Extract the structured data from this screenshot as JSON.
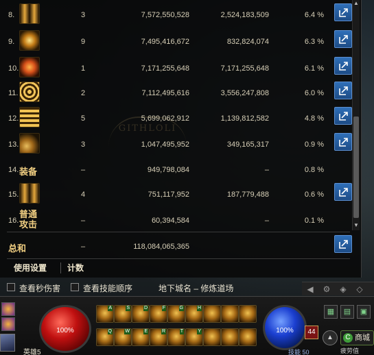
{
  "stats": {
    "rows": [
      {
        "rank": "8.",
        "icon": "claw-slash-skill-icon",
        "hits": "3",
        "total": "7,572,550,528",
        "avg": "2,524,183,509",
        "pct": "6.4 %"
      },
      {
        "rank": "9.",
        "icon": "crescent-wave-skill-icon",
        "hits": "9",
        "total": "7,495,416,672",
        "avg": "832,824,074",
        "pct": "6.3 %"
      },
      {
        "rank": "10.",
        "icon": "fire-orb-skill-icon",
        "hits": "1",
        "total": "7,171,255,648",
        "avg": "7,171,255,648",
        "pct": "6.1 %"
      },
      {
        "rank": "11.",
        "icon": "vortex-eye-skill-icon",
        "hits": "2",
        "total": "7,112,495,616",
        "avg": "3,556,247,808",
        "pct": "6.0 %"
      },
      {
        "rank": "12.",
        "icon": "golden-arch-skill-icon",
        "hits": "5",
        "total": "5,699,062,912",
        "avg": "1,139,812,582",
        "pct": "4.8 %"
      },
      {
        "rank": "13.",
        "icon": "shadow-strike-skill-icon",
        "hits": "3",
        "total": "1,047,495,952",
        "avg": "349,165,317",
        "pct": "0.9 %"
      },
      {
        "rank": "14.",
        "name": "装备",
        "hits": "–",
        "total": "949,798,084",
        "avg": "–",
        "pct": "0.8 %"
      },
      {
        "rank": "15.",
        "icon": "tornado-skill-icon",
        "hits": "4",
        "total": "751,117,952",
        "avg": "187,779,488",
        "pct": "0.6 %"
      },
      {
        "rank": "16.",
        "name": "普通\n攻击",
        "hits": "–",
        "total": "60,394,584",
        "avg": "–",
        "pct": "0.1 %"
      }
    ],
    "summary": {
      "label": "总和",
      "hits": "–",
      "total": "118,084,065,365"
    },
    "tabs": [
      "使用设置",
      "计数"
    ],
    "watermark": "GITHLOLI"
  },
  "options": {
    "show_dps": "查看秒伤害",
    "show_order": "查看技能顺序",
    "dungeon": "地下城名 – 修炼道场"
  },
  "hud": {
    "hp_percent": "100%",
    "mp_percent": "100%",
    "hero_name": "英雄5",
    "level": "44",
    "skill_label": "技能",
    "skill_value": "50",
    "shop": "商城",
    "fatigue": "疲劳值",
    "slot_keys_top": [
      "A",
      "S",
      "D",
      "F",
      "G",
      "H",
      "",
      "",
      ""
    ],
    "slot_keys_bottom": [
      "Q",
      "W",
      "E",
      "R",
      "T",
      "Y",
      "",
      "",
      ""
    ]
  },
  "colors": {
    "share_button": "#2f6fb8",
    "hp": "#c01010",
    "mp": "#1b3fd0",
    "gold_text": "#f1cf82"
  }
}
